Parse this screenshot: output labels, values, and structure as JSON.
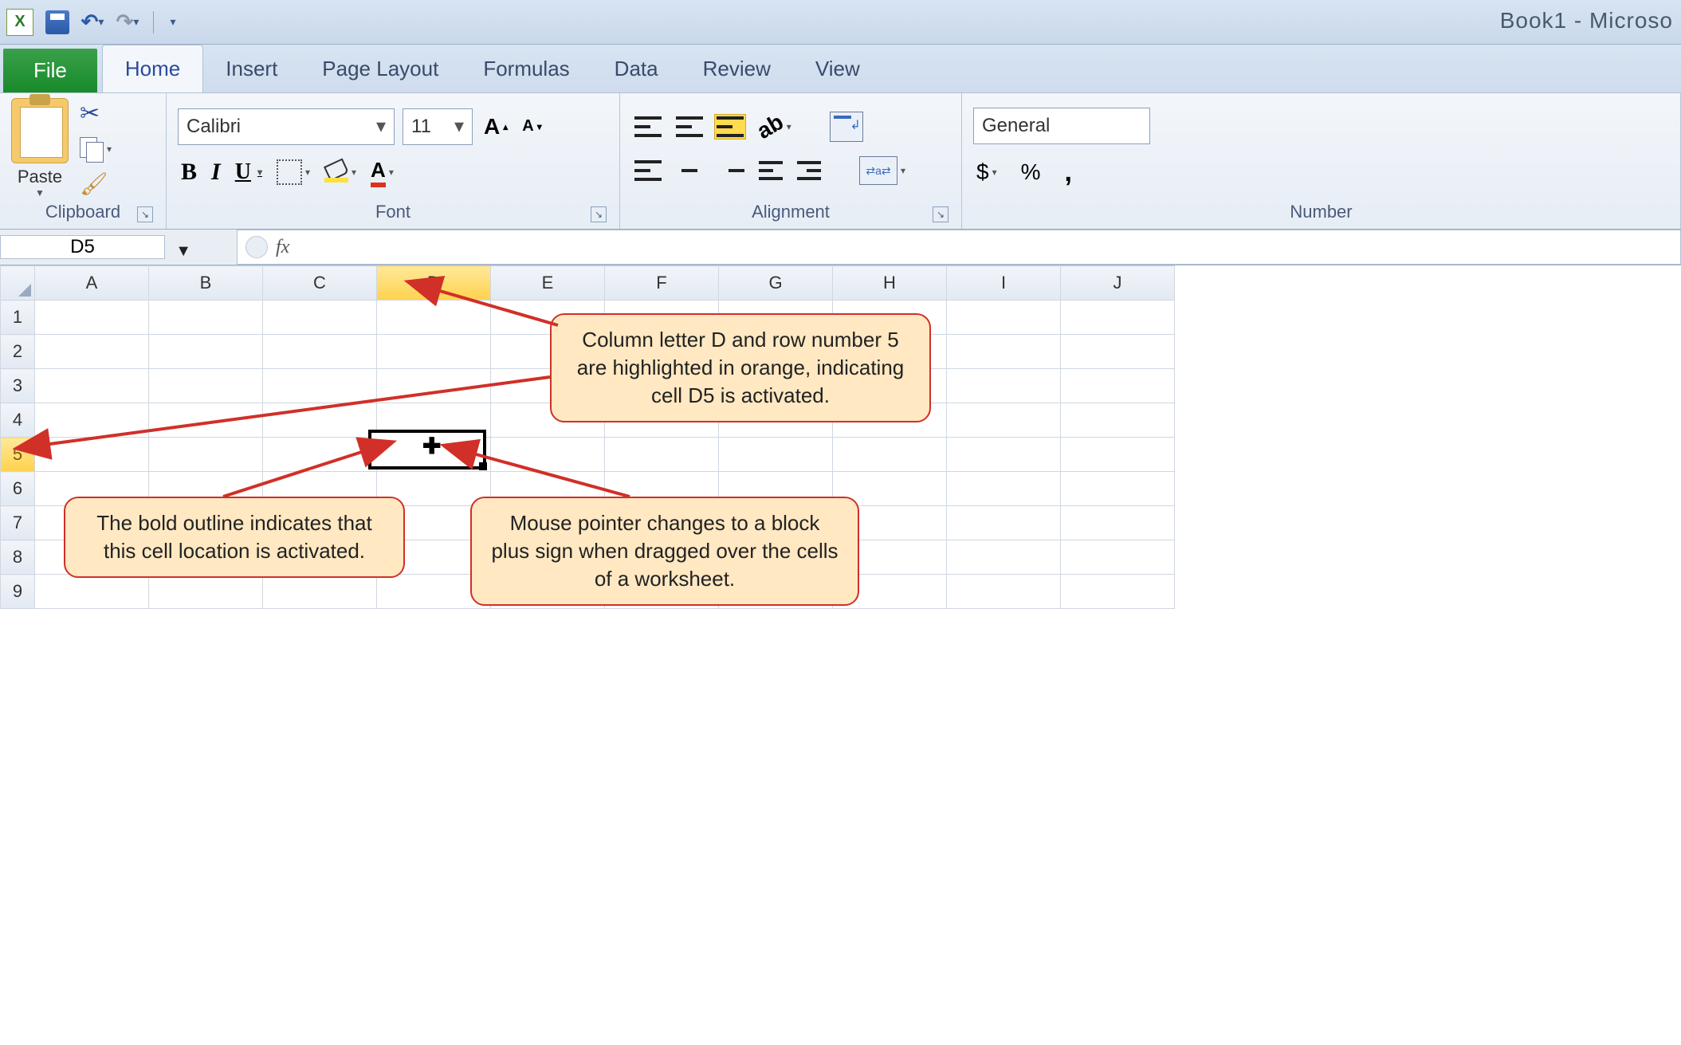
{
  "title": "Book1 - Microso",
  "qat": {
    "save": "Save",
    "undo": "Undo",
    "redo": "Redo"
  },
  "tabs": {
    "file": "File",
    "items": [
      "Home",
      "Insert",
      "Page Layout",
      "Formulas",
      "Data",
      "Review",
      "View"
    ],
    "active": "Home"
  },
  "ribbon": {
    "clipboard": {
      "paste": "Paste",
      "label": "Clipboard"
    },
    "font": {
      "name": "Calibri",
      "size": "11",
      "label": "Font",
      "bold": "B",
      "italic": "I",
      "underline": "U",
      "fontcolor_glyph": "A"
    },
    "alignment": {
      "label": "Alignment"
    },
    "number": {
      "format": "General",
      "label": "Number",
      "currency": "$",
      "percent": "%",
      "comma": ","
    }
  },
  "formula_bar": {
    "name_box": "D5",
    "fx": "fx",
    "value": ""
  },
  "grid": {
    "columns": [
      "A",
      "B",
      "C",
      "D",
      "E",
      "F",
      "G",
      "H",
      "I",
      "J"
    ],
    "rows": [
      "1",
      "2",
      "3",
      "4",
      "5",
      "6",
      "7",
      "8",
      "9"
    ],
    "active_col": "D",
    "active_row": "5"
  },
  "callouts": {
    "c1": "Column letter D and row number 5 are highlighted in orange, indicating cell D5 is activated.",
    "c2": "The bold outline indicates that this cell location is activated.",
    "c3": "Mouse pointer changes to a block plus sign when dragged over the cells of a worksheet."
  }
}
